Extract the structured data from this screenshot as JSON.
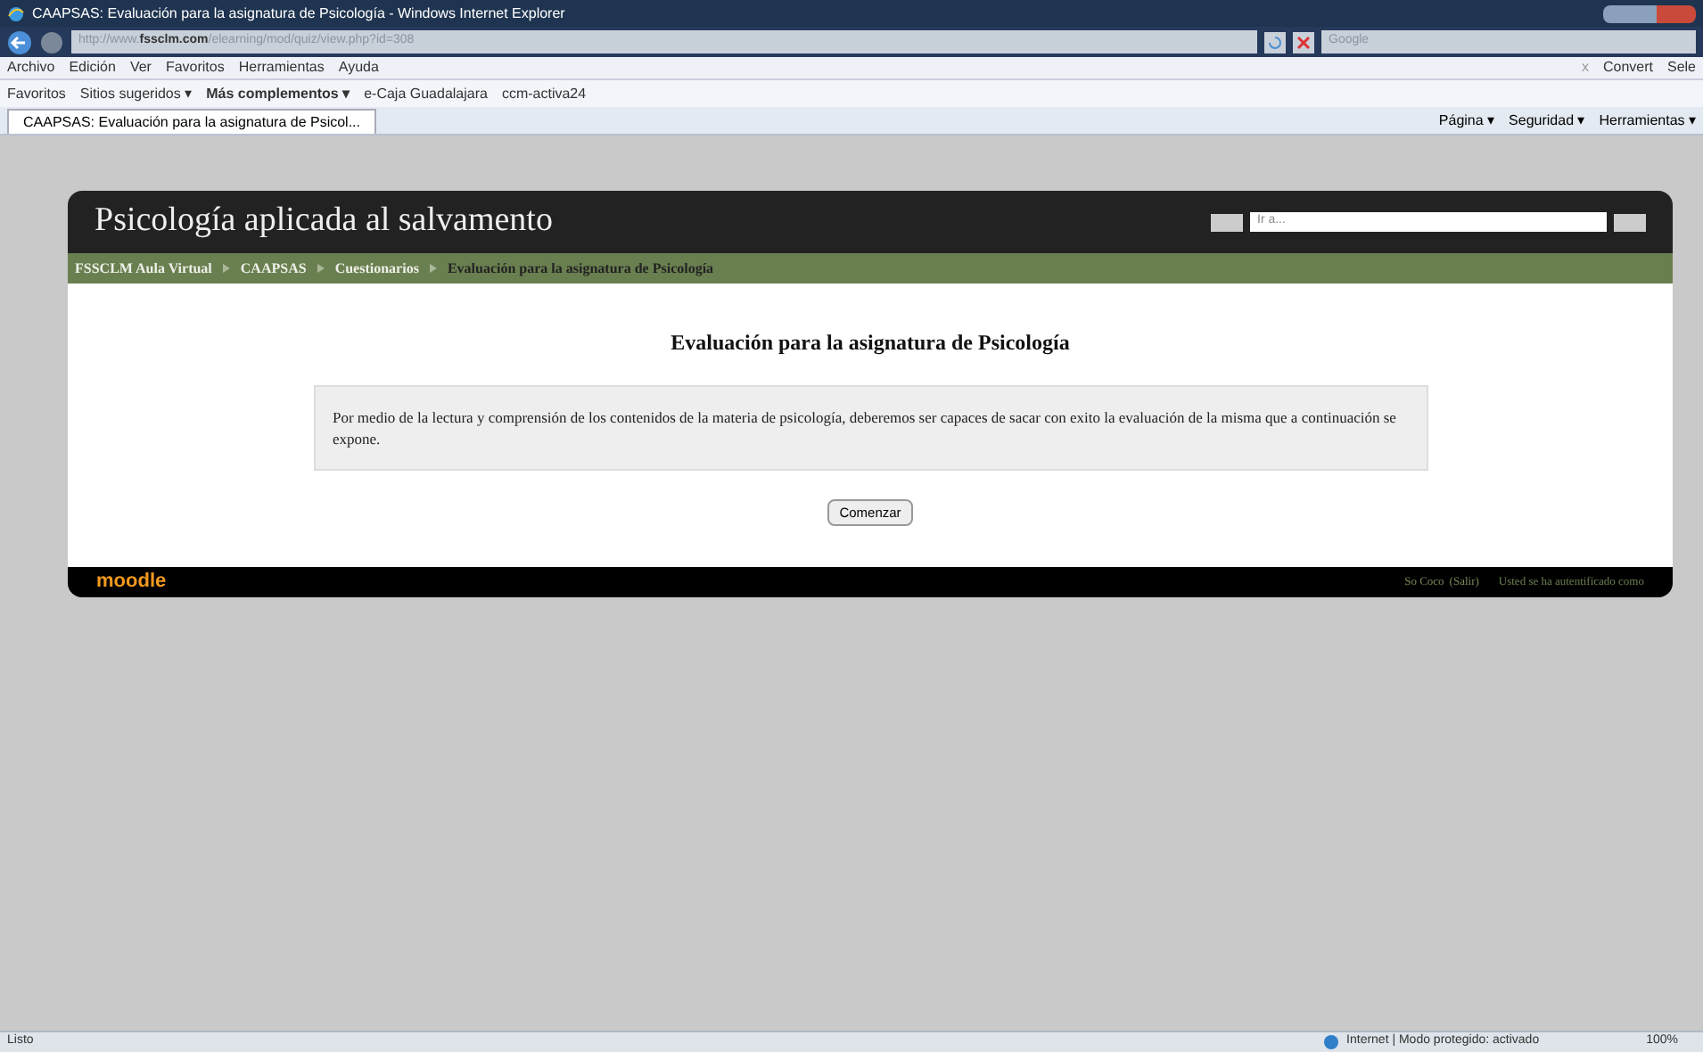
{
  "window": {
    "title": "CAAPSAS: Evaluación para la asignatura de Psicología - Windows Internet Explorer"
  },
  "address_bar": {
    "url_prefix": "http://www.",
    "url_domain": "fssclm.com",
    "url_path": "/elearning/mod/quiz/view.php?id=308",
    "search_placeholder": "Google"
  },
  "menu_bar": {
    "items": [
      "Archivo",
      "Edición",
      "Ver",
      "Favoritos",
      "Herramientas",
      "Ayuda"
    ],
    "close": "x",
    "convert": "Convert",
    "select": "Sele"
  },
  "favorites_bar": {
    "items": [
      {
        "label": "Favoritos",
        "bold": false
      },
      {
        "label": "Sitios sugeridos ▾",
        "bold": false
      },
      {
        "label": "Más complementos ▾",
        "bold": true
      },
      {
        "label": "e-Caja Guadalajara",
        "bold": false
      },
      {
        "label": "ccm-activa24",
        "bold": false
      }
    ]
  },
  "tabs": [
    {
      "label": "CAAPSAS: Evaluación para la asignatura de Psicol...",
      "selected": true
    }
  ],
  "command_bar": [
    "Página ▾",
    "Seguridad ▾",
    "Herramientas ▾"
  ],
  "page": {
    "site_title": "Psicología aplicada al salvamento",
    "jump_placeholder": "Ir a...",
    "breadcrumb": [
      {
        "label": "FSSCLM Aula Virtual",
        "current": false
      },
      {
        "label": "CAAPSAS",
        "current": false
      },
      {
        "label": "Cuestionarios",
        "current": false
      },
      {
        "label": "Evaluación para la asignatura de Psicología",
        "current": true
      }
    ],
    "heading": "Evaluación para la asignatura de Psicología",
    "intro": "Por medio de la lectura y comprensión de los contenidos de la materia de psicología, deberemos ser capaces de sacar con exito la evaluación de la misma que a continuación se expone.",
    "start_button": "Comenzar",
    "footer": {
      "logo": "moodle",
      "user": "So Coco",
      "logout": "(Salir)",
      "login_info": "Usted se ha autentificado como"
    }
  },
  "status_bar": {
    "text": "Listo",
    "zone": "Internet | Modo protegido: activado",
    "zoom": "100%"
  }
}
